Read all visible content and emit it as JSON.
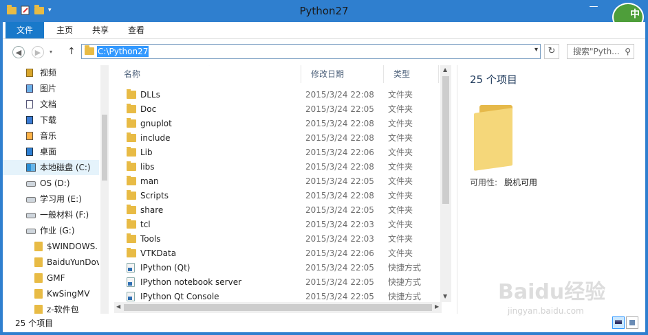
{
  "window": {
    "title": "Python27",
    "controls": {
      "minimize": "—",
      "maximize": "□",
      "close": "✕"
    }
  },
  "ime": {
    "label": "中"
  },
  "ribbon": {
    "tabs": [
      "文件",
      "主页",
      "共享",
      "查看"
    ]
  },
  "address": {
    "path": "C:\\Python27",
    "search_placeholder": "搜索\"Pyth...",
    "icons": [
      "back-icon",
      "forward-icon",
      "up-icon",
      "refresh-icon",
      "search-icon"
    ]
  },
  "nav": {
    "items": [
      {
        "label": "视频",
        "icon": "video-library-icon"
      },
      {
        "label": "图片",
        "icon": "picture-library-icon"
      },
      {
        "label": "文档",
        "icon": "document-library-icon"
      },
      {
        "label": "下载",
        "icon": "download-library-icon"
      },
      {
        "label": "音乐",
        "icon": "music-library-icon"
      },
      {
        "label": "桌面",
        "icon": "desktop-icon"
      },
      {
        "label": "本地磁盘 (C:)",
        "icon": "windows-drive-icon",
        "selected": true
      },
      {
        "label": "OS (D:)",
        "icon": "drive-icon"
      },
      {
        "label": "学习用 (E:)",
        "icon": "drive-icon"
      },
      {
        "label": "一般材料 (F:)",
        "icon": "drive-icon"
      },
      {
        "label": "作业 (G:)",
        "icon": "drive-icon"
      },
      {
        "label": "$WINDOWS.",
        "icon": "folder-icon"
      },
      {
        "label": "BaiduYunDov",
        "icon": "folder-icon"
      },
      {
        "label": "GMF",
        "icon": "folder-icon"
      },
      {
        "label": "KwSingMV",
        "icon": "folder-icon"
      },
      {
        "label": "z-软件包",
        "icon": "folder-icon"
      }
    ]
  },
  "list": {
    "headers": {
      "name": "名称",
      "date": "修改日期",
      "type": "类型"
    },
    "rows": [
      {
        "name": "DLLs",
        "date": "2015/3/24 22:08",
        "type": "文件夹",
        "kind": "folder"
      },
      {
        "name": "Doc",
        "date": "2015/3/24 22:05",
        "type": "文件夹",
        "kind": "folder"
      },
      {
        "name": "gnuplot",
        "date": "2015/3/24 22:08",
        "type": "文件夹",
        "kind": "folder"
      },
      {
        "name": "include",
        "date": "2015/3/24 22:08",
        "type": "文件夹",
        "kind": "folder"
      },
      {
        "name": "Lib",
        "date": "2015/3/24 22:06",
        "type": "文件夹",
        "kind": "folder"
      },
      {
        "name": "libs",
        "date": "2015/3/24 22:08",
        "type": "文件夹",
        "kind": "folder"
      },
      {
        "name": "man",
        "date": "2015/3/24 22:05",
        "type": "文件夹",
        "kind": "folder"
      },
      {
        "name": "Scripts",
        "date": "2015/3/24 22:08",
        "type": "文件夹",
        "kind": "folder"
      },
      {
        "name": "share",
        "date": "2015/3/24 22:05",
        "type": "文件夹",
        "kind": "folder"
      },
      {
        "name": "tcl",
        "date": "2015/3/24 22:03",
        "type": "文件夹",
        "kind": "folder"
      },
      {
        "name": "Tools",
        "date": "2015/3/24 22:03",
        "type": "文件夹",
        "kind": "folder"
      },
      {
        "name": "VTKData",
        "date": "2015/3/24 22:06",
        "type": "文件夹",
        "kind": "folder"
      },
      {
        "name": "IPython (Qt)",
        "date": "2015/3/24 22:05",
        "type": "快捷方式",
        "kind": "shortcut"
      },
      {
        "name": "IPython notebook server",
        "date": "2015/3/24 22:05",
        "type": "快捷方式",
        "kind": "shortcut"
      },
      {
        "name": "IPython Qt Console",
        "date": "2015/3/24 22:05",
        "type": "快捷方式",
        "kind": "shortcut"
      }
    ]
  },
  "details": {
    "count": "25 个项目",
    "availability_label": "可用性:",
    "availability_value": "脱机可用"
  },
  "status": {
    "text": "25 个项目"
  },
  "watermark": {
    "brand": "Baidu经验",
    "url": "jingyan.baidu.com"
  }
}
